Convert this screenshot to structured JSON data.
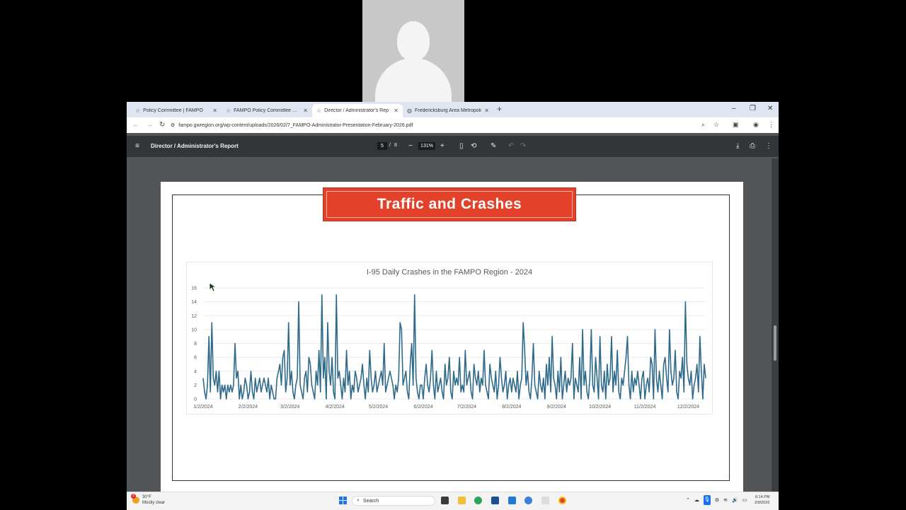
{
  "browser": {
    "tabs": [
      {
        "label": "Policy Committee | FAMPO",
        "active": false
      },
      {
        "label": "FAMPO Policy Committee Age",
        "active": false
      },
      {
        "label": "Director / Administrator's Rep",
        "active": true
      },
      {
        "label": "Fredericksburg Area Metropoli",
        "active": false
      }
    ],
    "new_tab": "+",
    "url": "fampo.gwregion.org/wp-content/uploads/2026/02/7_FAMPO-Administrator-Presentation-February-2026.pdf"
  },
  "pdf": {
    "title": "Director / Administrator's Report",
    "page_current": "5",
    "page_separator": "/",
    "page_total": "8",
    "zoom": "131%"
  },
  "slide": {
    "title": "Traffic and Crashes"
  },
  "chart_data": {
    "type": "line",
    "title": "I-95 Daily Crashes in the FAMPO Region - 2024",
    "xlabel": "",
    "ylabel": "",
    "ylim": [
      0,
      16
    ],
    "yticks": [
      "0",
      "2",
      "4",
      "6",
      "8",
      "10",
      "12",
      "14",
      "16"
    ],
    "x_tick_labels": [
      "1/2/2024",
      "2/2/2024",
      "3/2/2024",
      "4/2/2024",
      "5/2/2024",
      "6/2/2024",
      "7/2/2024",
      "8/2/2024",
      "9/2/2024",
      "10/2/2024",
      "11/2/2024",
      "12/2/2024"
    ],
    "x_start": "1/2/2024",
    "color": "#2e6a8a",
    "grid": "horizontal",
    "values": [
      3,
      1,
      0,
      2,
      9,
      1,
      11,
      3,
      2,
      4,
      1,
      4,
      0,
      2,
      1,
      2,
      0,
      2,
      1,
      2,
      1,
      2,
      8,
      3,
      4,
      0,
      2,
      0,
      1,
      3,
      2,
      0,
      1,
      4,
      1,
      0,
      3,
      1,
      2,
      3,
      1,
      2,
      3,
      2,
      1,
      3,
      0,
      2,
      1,
      0,
      0,
      3,
      4,
      5,
      2,
      6,
      7,
      1,
      3,
      11,
      2,
      4,
      1,
      0,
      2,
      3,
      14,
      2,
      1,
      0,
      3,
      4,
      1,
      6,
      5,
      2,
      1,
      0,
      4,
      2,
      7,
      1,
      15,
      3,
      6,
      0,
      11,
      4,
      2,
      6,
      1,
      0,
      15,
      3,
      4,
      2,
      0,
      3,
      1,
      7,
      2,
      4,
      0,
      2,
      1,
      4,
      3,
      1,
      2,
      3,
      5,
      2,
      0,
      3,
      1,
      7,
      3,
      1,
      2,
      4,
      1,
      2,
      3,
      4,
      2,
      8,
      1,
      2,
      3,
      4,
      3,
      2,
      0,
      2,
      1,
      3,
      11,
      10,
      2,
      3,
      4,
      1,
      0,
      5,
      8,
      2,
      15,
      3,
      1,
      0,
      2,
      2,
      0,
      3,
      5,
      2,
      1,
      3,
      7,
      2,
      0,
      4,
      1,
      2,
      3,
      1,
      0,
      5,
      2,
      3,
      6,
      1,
      0,
      4,
      2,
      3,
      2,
      6,
      1,
      2,
      1,
      7,
      2,
      3,
      4,
      1,
      0,
      5,
      3,
      2,
      4,
      1,
      3,
      2,
      7,
      2,
      1,
      0,
      5,
      3,
      2,
      1,
      4,
      0,
      2,
      6,
      3,
      1,
      2,
      4,
      0,
      2,
      3,
      1,
      3,
      2,
      1,
      4,
      0,
      2,
      3,
      11,
      7,
      2,
      4,
      1,
      0,
      3,
      8,
      2,
      1,
      0,
      4,
      2,
      1,
      3,
      0,
      5,
      2,
      6,
      1,
      9,
      3,
      2,
      0,
      4,
      1,
      6,
      0,
      2,
      4,
      1,
      3,
      2,
      3,
      8,
      0,
      3,
      2,
      1,
      6,
      0,
      10,
      2,
      4,
      1,
      0,
      3,
      10,
      2,
      1,
      6,
      3,
      0,
      9,
      2,
      1,
      4,
      0,
      5,
      2,
      3,
      9,
      1,
      4,
      2,
      7,
      1,
      0,
      3,
      2,
      4,
      6,
      9,
      2,
      0,
      4,
      1,
      3,
      2,
      4,
      2,
      0,
      3,
      4,
      0,
      2,
      3,
      1,
      6,
      5,
      0,
      10,
      3,
      1,
      4,
      2,
      0,
      5,
      6,
      3,
      1,
      10,
      4,
      2,
      3,
      7,
      1,
      0,
      4,
      3,
      6,
      1,
      14,
      5,
      3,
      2,
      4,
      0,
      2,
      3,
      5,
      1,
      9,
      4,
      0,
      5,
      3
    ]
  },
  "taskbar": {
    "weather_temp": "30°F",
    "weather_text": "Mostly clear",
    "weather_badge": "2",
    "search_label": "Search",
    "time": "6:14 PM",
    "date": "2/9/2026"
  }
}
